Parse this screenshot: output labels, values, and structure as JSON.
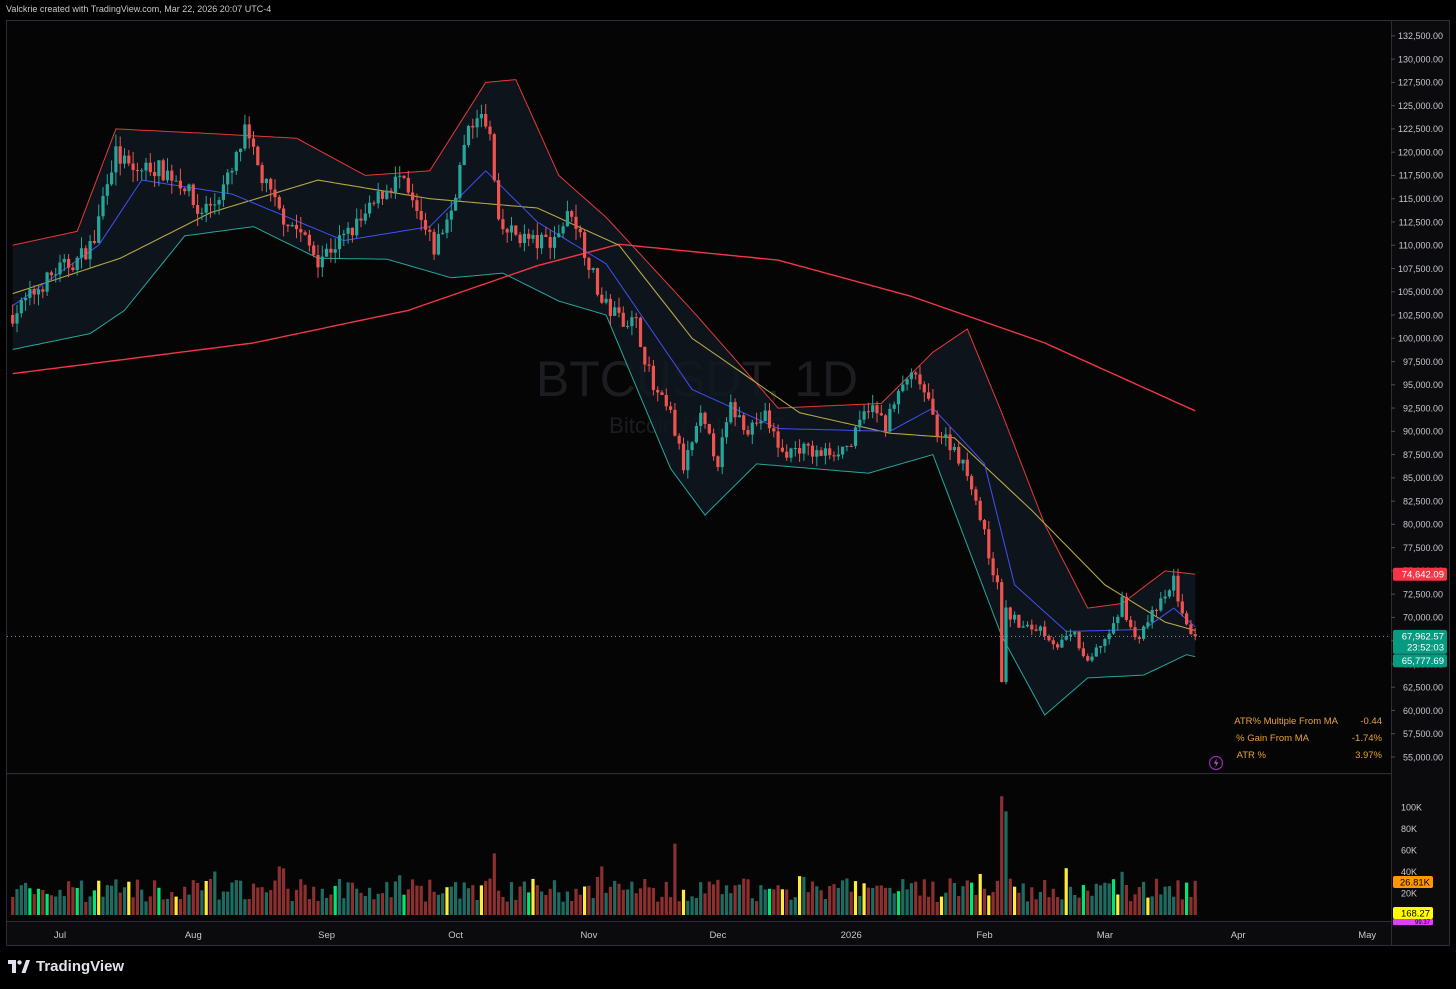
{
  "caption": "Valckrie created with TradingView.com, Mar 22, 2026 20:07 UTC-4",
  "footer": {
    "brand": "TradingView"
  },
  "watermark": {
    "line1": "BTCUSDT, 1D",
    "line2": "Bitcoin / TetherUS"
  },
  "info_table": [
    {
      "label": "ATR% Multiple From MA",
      "value": "-0.44"
    },
    {
      "label": "% Gain From MA",
      "value": "-1.74%"
    },
    {
      "label": "ATR %",
      "value": "3.97%"
    }
  ],
  "price_tags": {
    "upper_band": {
      "value": "74,642.09",
      "color": "#f23645"
    },
    "last": {
      "value": "67,962.57",
      "countdown": "23:52:03",
      "color": "#089981"
    },
    "lower_band": {
      "value": "65,777.69",
      "color": "#089981"
    }
  },
  "volume_tags": [
    {
      "value": "26.81K",
      "color": "#ff9800"
    },
    {
      "value": "168.27",
      "color": "#ffff00"
    },
    {
      "value": "99.37",
      "color": "#e040fb"
    }
  ],
  "colors": {
    "up": "#26a69a",
    "down": "#ef5350",
    "ma20": "#3f51f5",
    "ma50": "#b5a642",
    "ma200": "#f23645",
    "band": "#e53935",
    "lower_band": "#26a69a",
    "vol_bright_up": "#00e676",
    "vol_yellow": "#ffeb3b"
  },
  "chart_data": {
    "type": "candlestick",
    "symbol": "BTCUSDT",
    "timeframe": "1D",
    "y_ticks": [
      55000,
      57500,
      60000,
      62500,
      65000,
      67500,
      70000,
      72500,
      75000,
      77500,
      80000,
      82500,
      85000,
      87500,
      90000,
      92500,
      95000,
      97500,
      100000,
      102500,
      105000,
      107500,
      110000,
      112500,
      115000,
      117500,
      120000,
      122500,
      125000,
      127500,
      130000,
      132500
    ],
    "y_tick_labels": [
      "55,000.00",
      "57,500.00",
      "60,000.00",
      "62,500.00",
      "65,000.00",
      "67,500.00",
      "70,000.00",
      "72,500.00",
      "75,000.00",
      "77,500.00",
      "80,000.00",
      "82,500.00",
      "85,000.00",
      "87,500.00",
      "90,000.00",
      "92,500.00",
      "95,000.00",
      "97,500.00",
      "100,000.00",
      "102,500.00",
      "105,000.00",
      "107,500.00",
      "110,000.00",
      "112,500.00",
      "115,000.00",
      "117,500.00",
      "120,000.00",
      "122,500.00",
      "125,000.00",
      "127,500.00",
      "130,000.00",
      "132,500.00"
    ],
    "x_ticks": [
      {
        "label": "Jul",
        "date": "2025-07-01"
      },
      {
        "label": "Aug",
        "date": "2025-08-01"
      },
      {
        "label": "Sep",
        "date": "2025-09-01"
      },
      {
        "label": "Oct",
        "date": "2025-10-01"
      },
      {
        "label": "Nov",
        "date": "2025-11-01"
      },
      {
        "label": "Dec",
        "date": "2025-12-01"
      },
      {
        "label": "2026",
        "date": "2026-01-01"
      },
      {
        "label": "Feb",
        "date": "2026-02-01"
      },
      {
        "label": "Mar",
        "date": "2026-03-01"
      },
      {
        "label": "Apr",
        "date": "2026-04-01"
      },
      {
        "label": "May",
        "date": "2026-05-01"
      }
    ],
    "volume_ticks": [
      {
        "value": 20000,
        "label": "20K"
      },
      {
        "value": 40000,
        "label": "40K"
      },
      {
        "value": 60000,
        "label": "60K"
      },
      {
        "value": 80000,
        "label": "80K"
      },
      {
        "value": 100000,
        "label": "100K"
      }
    ],
    "last_price": 67962.57,
    "close_path": [
      [
        "2025-06-20",
        102500
      ],
      [
        "2025-06-24",
        104500
      ],
      [
        "2025-06-30",
        107200
      ],
      [
        "2025-07-05",
        108400
      ],
      [
        "2025-07-09",
        110500
      ],
      [
        "2025-07-12",
        117500
      ],
      [
        "2025-07-14",
        119800
      ],
      [
        "2025-07-18",
        117800
      ],
      [
        "2025-07-22",
        118500
      ],
      [
        "2025-07-26",
        117800
      ],
      [
        "2025-07-30",
        116500
      ],
      [
        "2025-08-02",
        113500
      ],
      [
        "2025-08-06",
        114700
      ],
      [
        "2025-08-10",
        117800
      ],
      [
        "2025-08-13",
        122000
      ],
      [
        "2025-08-17",
        117200
      ],
      [
        "2025-08-21",
        113500
      ],
      [
        "2025-08-25",
        111800
      ],
      [
        "2025-08-30",
        108600
      ],
      [
        "2025-09-05",
        110800
      ],
      [
        "2025-09-10",
        113000
      ],
      [
        "2025-09-14",
        115700
      ],
      [
        "2025-09-18",
        117200
      ],
      [
        "2025-09-22",
        113200
      ],
      [
        "2025-09-26",
        109600
      ],
      [
        "2025-09-30",
        113800
      ],
      [
        "2025-10-03",
        120500
      ],
      [
        "2025-10-06",
        124500
      ],
      [
        "2025-10-09",
        121500
      ],
      [
        "2025-10-11",
        111800
      ],
      [
        "2025-10-15",
        111200
      ],
      [
        "2025-10-20",
        110200
      ],
      [
        "2025-10-24",
        110800
      ],
      [
        "2025-10-28",
        113800
      ],
      [
        "2025-10-31",
        109600
      ],
      [
        "2025-11-04",
        103800
      ],
      [
        "2025-11-08",
        102300
      ],
      [
        "2025-11-12",
        101600
      ],
      [
        "2025-11-16",
        94500
      ],
      [
        "2025-11-20",
        91700
      ],
      [
        "2025-11-23",
        86200
      ],
      [
        "2025-11-27",
        91300
      ],
      [
        "2025-12-01",
        86800
      ],
      [
        "2025-12-04",
        92500
      ],
      [
        "2025-12-08",
        90400
      ],
      [
        "2025-12-12",
        91600
      ],
      [
        "2025-12-16",
        87500
      ],
      [
        "2025-12-20",
        88300
      ],
      [
        "2025-12-24",
        87500
      ],
      [
        "2025-12-28",
        87900
      ],
      [
        "2026-01-01",
        88600
      ],
      [
        "2026-01-05",
        92800
      ],
      [
        "2026-01-09",
        90800
      ],
      [
        "2026-01-14",
        95800
      ],
      [
        "2026-01-17",
        95300
      ],
      [
        "2026-01-21",
        90200
      ],
      [
        "2026-01-25",
        88200
      ],
      [
        "2026-01-29",
        84500
      ],
      [
        "2026-02-01",
        78800
      ],
      [
        "2026-02-04",
        73200
      ],
      [
        "2026-02-05",
        63500
      ],
      [
        "2026-02-06",
        70600
      ],
      [
        "2026-02-10",
        68800
      ],
      [
        "2026-02-14",
        68900
      ],
      [
        "2026-02-18",
        67000
      ],
      [
        "2026-02-22",
        68000
      ],
      [
        "2026-02-25",
        64800
      ],
      [
        "2026-02-28",
        67200
      ],
      [
        "2026-03-03",
        68800
      ],
      [
        "2026-03-05",
        71800
      ],
      [
        "2026-03-08",
        67500
      ],
      [
        "2026-03-12",
        70300
      ],
      [
        "2026-03-16",
        72700
      ],
      [
        "2026-03-17",
        74300
      ],
      [
        "2026-03-19",
        70000
      ],
      [
        "2026-03-22",
        67962.57
      ]
    ],
    "ma200": [
      [
        "2025-06-20",
        96200
      ],
      [
        "2025-08-15",
        99500
      ],
      [
        "2025-09-20",
        103000
      ],
      [
        "2025-10-20",
        107800
      ],
      [
        "2025-11-08",
        110100
      ],
      [
        "2025-12-15",
        108400
      ],
      [
        "2026-01-15",
        104500
      ],
      [
        "2026-02-15",
        99500
      ],
      [
        "2026-03-22",
        92200
      ]
    ],
    "ma50": [
      [
        "2025-06-20",
        104800
      ],
      [
        "2025-07-15",
        108600
      ],
      [
        "2025-08-05",
        113500
      ],
      [
        "2025-08-30",
        117000
      ],
      [
        "2025-09-25",
        115000
      ],
      [
        "2025-10-20",
        114000
      ],
      [
        "2025-11-08",
        110000
      ],
      [
        "2025-11-25",
        100000
      ],
      [
        "2025-12-20",
        92000
      ],
      [
        "2026-01-10",
        89800
      ],
      [
        "2026-01-25",
        89300
      ],
      [
        "2026-02-12",
        81500
      ],
      [
        "2026-03-01",
        73500
      ],
      [
        "2026-03-15",
        69500
      ],
      [
        "2026-03-22",
        68600
      ]
    ],
    "ma20": [
      [
        "2025-06-20",
        103500
      ],
      [
        "2025-07-10",
        110000
      ],
      [
        "2025-07-20",
        117000
      ],
      [
        "2025-08-10",
        115500
      ],
      [
        "2025-09-05",
        110500
      ],
      [
        "2025-09-25",
        112000
      ],
      [
        "2025-10-08",
        118000
      ],
      [
        "2025-10-20",
        112500
      ],
      [
        "2025-11-05",
        108000
      ],
      [
        "2025-11-25",
        94500
      ],
      [
        "2025-12-15",
        90300
      ],
      [
        "2026-01-10",
        90000
      ],
      [
        "2026-01-20",
        92500
      ],
      [
        "2026-02-01",
        86500
      ],
      [
        "2026-02-08",
        73500
      ],
      [
        "2026-02-20",
        68500
      ],
      [
        "2026-03-10",
        68700
      ],
      [
        "2026-03-17",
        71000
      ],
      [
        "2026-03-22",
        69000
      ]
    ],
    "upper_band": [
      [
        "2025-06-20",
        110000
      ],
      [
        "2025-07-05",
        111500
      ],
      [
        "2025-07-14",
        122500
      ],
      [
        "2025-08-05",
        122000
      ],
      [
        "2025-08-25",
        121500
      ],
      [
        "2025-09-10",
        117500
      ],
      [
        "2025-09-25",
        118000
      ],
      [
        "2025-10-08",
        127500
      ],
      [
        "2025-10-15",
        127800
      ],
      [
        "2025-10-25",
        117500
      ],
      [
        "2025-11-05",
        113000
      ],
      [
        "2025-11-25",
        103000
      ],
      [
        "2025-12-15",
        92500
      ],
      [
        "2026-01-08",
        93000
      ],
      [
        "2026-01-20",
        98500
      ],
      [
        "2026-01-28",
        101000
      ],
      [
        "2026-02-05",
        92000
      ],
      [
        "2026-02-15",
        80000
      ],
      [
        "2026-02-25",
        71000
      ],
      [
        "2026-03-05",
        71500
      ],
      [
        "2026-03-15",
        75000
      ],
      [
        "2026-03-22",
        74642
      ]
    ],
    "lower_band": [
      [
        "2025-06-20",
        98800
      ],
      [
        "2025-07-08",
        100500
      ],
      [
        "2025-07-16",
        103000
      ],
      [
        "2025-07-30",
        111000
      ],
      [
        "2025-08-15",
        112000
      ],
      [
        "2025-08-30",
        108600
      ],
      [
        "2025-09-15",
        108500
      ],
      [
        "2025-09-30",
        106500
      ],
      [
        "2025-10-12",
        107000
      ],
      [
        "2025-10-25",
        104000
      ],
      [
        "2025-11-05",
        102500
      ],
      [
        "2025-11-20",
        86000
      ],
      [
        "2025-11-28",
        81000
      ],
      [
        "2025-12-10",
        86500
      ],
      [
        "2026-01-05",
        85500
      ],
      [
        "2026-01-20",
        87500
      ],
      [
        "2026-02-05",
        68000
      ],
      [
        "2026-02-15",
        59500
      ],
      [
        "2026-02-25",
        63500
      ],
      [
        "2026-03-10",
        63800
      ],
      [
        "2026-03-20",
        66000
      ],
      [
        "2026-03-22",
        65778
      ]
    ],
    "volume_spikes": [
      [
        "2025-10-10",
        57000
      ],
      [
        "2025-11-04",
        45000
      ],
      [
        "2025-11-21",
        66000
      ],
      [
        "2026-02-05",
        110000
      ],
      [
        "2026-02-06",
        96000
      ],
      [
        "2026-01-31",
        38000
      ],
      [
        "2026-03-05",
        40000
      ]
    ]
  }
}
